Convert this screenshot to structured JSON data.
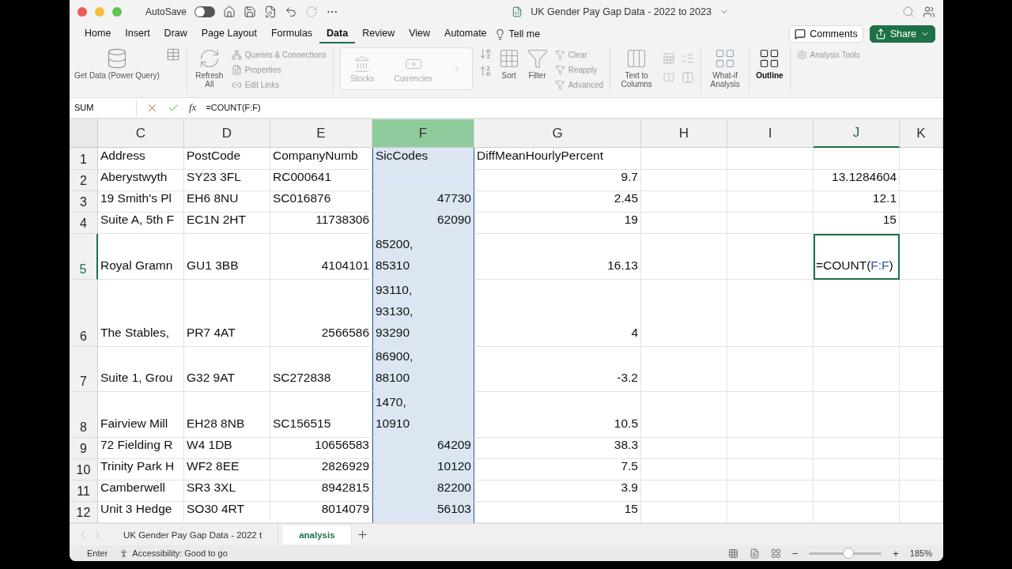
{
  "window": {
    "title": "UK Gender Pay Gap Data - 2022 to 2023",
    "autosave_label": "AutoSave",
    "autosave_on": false
  },
  "ribbon_tabs": [
    {
      "label": "Home",
      "selected": false
    },
    {
      "label": "Insert",
      "selected": false
    },
    {
      "label": "Draw",
      "selected": false
    },
    {
      "label": "Page Layout",
      "selected": false
    },
    {
      "label": "Formulas",
      "selected": false
    },
    {
      "label": "Data",
      "selected": true
    },
    {
      "label": "Review",
      "selected": false
    },
    {
      "label": "View",
      "selected": false
    },
    {
      "label": "Automate",
      "selected": false
    }
  ],
  "tell_me": "Tell me",
  "comments": "Comments",
  "share": "Share",
  "ribbon": {
    "get_data": "Get Data (Power Query)",
    "refresh_all": "Refresh All",
    "queries": [
      {
        "label": "Queries & Connections",
        "disabled": true
      },
      {
        "label": "Properties",
        "disabled": true
      },
      {
        "label": "Edit Links",
        "disabled": true
      }
    ],
    "data_types": [
      {
        "label": "Stocks",
        "disabled": true
      },
      {
        "label": "Currencies",
        "disabled": true
      }
    ],
    "sort": "Sort",
    "filter": "Filter",
    "filter_options": [
      {
        "label": "Clear",
        "disabled": true
      },
      {
        "label": "Reapply",
        "disabled": true
      },
      {
        "label": "Advanced",
        "disabled": true
      }
    ],
    "text_to_columns": "Text to Columns",
    "what_if": "What-if Analysis",
    "outline": "Outline",
    "analysis_tools": "Analysis Tools"
  },
  "formula_bar": {
    "name_box": "SUM",
    "function_label": "fx",
    "formula": "=COUNT(F:F)"
  },
  "columns": [
    {
      "label": "C",
      "selected": false,
      "active": false
    },
    {
      "label": "D",
      "selected": false,
      "active": false
    },
    {
      "label": "E",
      "selected": false,
      "active": false
    },
    {
      "label": "F",
      "selected": true,
      "active": false
    },
    {
      "label": "G",
      "selected": false,
      "active": false
    },
    {
      "label": "H",
      "selected": false,
      "active": false
    },
    {
      "label": "I",
      "selected": false,
      "active": false
    },
    {
      "label": "J",
      "selected": false,
      "active": true
    },
    {
      "label": "K",
      "selected": false,
      "active": false
    }
  ],
  "rows": [
    {
      "number": "1",
      "active": false,
      "cells": [
        {
          "text": "Address",
          "kind": "text"
        },
        {
          "text": "PostCode",
          "kind": "text"
        },
        {
          "text": "CompanyNumb",
          "kind": "text"
        },
        {
          "text": "SicCodes",
          "kind": "text"
        },
        {
          "text": "DiffMeanHourlyPercent",
          "kind": "text"
        },
        null,
        null,
        null,
        null
      ]
    },
    {
      "number": "2",
      "active": false,
      "cells": [
        {
          "text": "Aberystwyth",
          "kind": "text"
        },
        {
          "text": "SY23 3FL",
          "kind": "text"
        },
        {
          "text": "RC000641",
          "kind": "text"
        },
        null,
        {
          "text": "9.7",
          "kind": "number"
        },
        null,
        null,
        {
          "text": "13.1284604",
          "kind": "number"
        },
        null
      ]
    },
    {
      "number": "3",
      "active": false,
      "cells": [
        {
          "text": "19 Smith's Pl",
          "kind": "text"
        },
        {
          "text": "EH6 8NU",
          "kind": "text"
        },
        {
          "text": "SC016876",
          "kind": "text"
        },
        {
          "text": "47730",
          "kind": "number"
        },
        {
          "text": "2.45",
          "kind": "number"
        },
        null,
        null,
        {
          "text": "12.1",
          "kind": "number"
        },
        null
      ]
    },
    {
      "number": "4",
      "active": false,
      "cells": [
        {
          "text": "Suite A, 5th F",
          "kind": "text"
        },
        {
          "text": "EC1N 2HT",
          "kind": "text"
        },
        {
          "text": "11738306",
          "kind": "number"
        },
        {
          "text": "62090",
          "kind": "number"
        },
        {
          "text": "19",
          "kind": "number"
        },
        null,
        null,
        {
          "text": "15",
          "kind": "number"
        },
        null
      ]
    },
    {
      "number": "5",
      "active": true,
      "cells": [
        {
          "text": "Royal Gramn",
          "kind": "text"
        },
        {
          "text": "GU1 3BB",
          "kind": "text"
        },
        {
          "text": "4104101",
          "kind": "number"
        },
        {
          "text": "85200,\n85310",
          "kind": "text"
        },
        {
          "text": "16.13",
          "kind": "number"
        },
        null,
        null,
        {
          "kind": "editing",
          "before": "=COUNT(",
          "reference": "F:F",
          "after": ")"
        },
        null
      ]
    },
    {
      "number": "6",
      "active": false,
      "cells": [
        {
          "text": "The Stables,",
          "kind": "text"
        },
        {
          "text": "PR7 4AT",
          "kind": "text"
        },
        {
          "text": "2566586",
          "kind": "number"
        },
        {
          "text": "93110,\n93130,\n93290",
          "kind": "text"
        },
        {
          "text": "4",
          "kind": "number"
        },
        null,
        null,
        null,
        null
      ]
    },
    {
      "number": "7",
      "active": false,
      "cells": [
        {
          "text": "Suite 1, Grou",
          "kind": "text"
        },
        {
          "text": "G32 9AT",
          "kind": "text"
        },
        {
          "text": "SC272838",
          "kind": "text"
        },
        {
          "text": "86900,\n88100",
          "kind": "text"
        },
        {
          "text": "-3.2",
          "kind": "number"
        },
        null,
        null,
        null,
        null
      ]
    },
    {
      "number": "8",
      "active": false,
      "cells": [
        {
          "text": "Fairview Mill",
          "kind": "text"
        },
        {
          "text": "EH28 8NB",
          "kind": "text"
        },
        {
          "text": "SC156515",
          "kind": "text"
        },
        {
          "text": "1470,\n10910",
          "kind": "text"
        },
        {
          "text": "10.5",
          "kind": "number"
        },
        null,
        null,
        null,
        null
      ]
    },
    {
      "number": "9",
      "active": false,
      "cells": [
        {
          "text": "72 Fielding R",
          "kind": "text"
        },
        {
          "text": "W4 1DB",
          "kind": "text"
        },
        {
          "text": "10656583",
          "kind": "number"
        },
        {
          "text": "64209",
          "kind": "number"
        },
        {
          "text": "38.3",
          "kind": "number"
        },
        null,
        null,
        null,
        null
      ]
    },
    {
      "number": "10",
      "active": false,
      "cells": [
        {
          "text": "Trinity Park H",
          "kind": "text"
        },
        {
          "text": "WF2 8EE",
          "kind": "text"
        },
        {
          "text": "2826929",
          "kind": "number"
        },
        {
          "text": "10120",
          "kind": "number"
        },
        {
          "text": "7.5",
          "kind": "number"
        },
        null,
        null,
        null,
        null
      ]
    },
    {
      "number": "11",
      "active": false,
      "cells": [
        {
          "text": "Camberwell",
          "kind": "text"
        },
        {
          "text": "SR3 3XL",
          "kind": "text"
        },
        {
          "text": "8942815",
          "kind": "number"
        },
        {
          "text": "82200",
          "kind": "number"
        },
        {
          "text": "3.9",
          "kind": "number"
        },
        null,
        null,
        null,
        null
      ]
    },
    {
      "number": "12",
      "active": false,
      "cells": [
        {
          "text": "Unit 3 Hedge",
          "kind": "text"
        },
        {
          "text": "SO30 4RT",
          "kind": "text"
        },
        {
          "text": "8014079",
          "kind": "number"
        },
        {
          "text": "56103",
          "kind": "number"
        },
        {
          "text": "15",
          "kind": "number"
        },
        null,
        null,
        null,
        null
      ]
    }
  ],
  "sheet_tabs": [
    {
      "label": "UK Gender Pay Gap Data - 2022 t",
      "selected": false
    },
    {
      "label": "analysis",
      "selected": true
    }
  ],
  "status_bar": {
    "mode": "Enter",
    "accessibility": "Accessibility: Good to go",
    "zoom_out": "−",
    "zoom_in": "+",
    "zoom": "185%",
    "zoom_slider": {
      "level": 0.55
    }
  }
}
